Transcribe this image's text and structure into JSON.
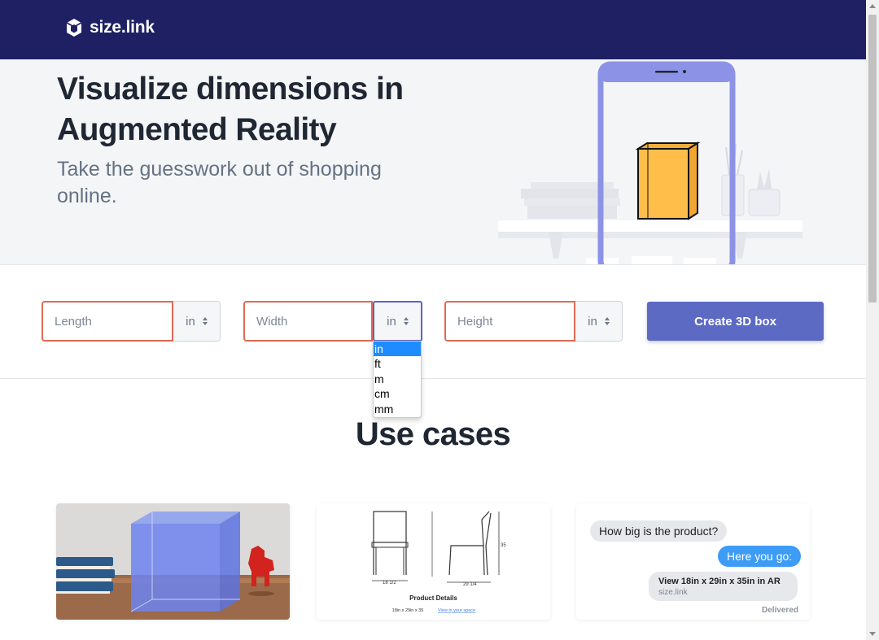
{
  "header": {
    "logo_text": "size.link",
    "logo_icon": "cube-icon"
  },
  "hero": {
    "title": "Visualize dimensions in Augmented Reality",
    "subtitle": "Take the guesswork out of shopping online."
  },
  "form": {
    "length": {
      "placeholder": "Length",
      "unit": "in"
    },
    "width": {
      "placeholder": "Width",
      "unit": "in"
    },
    "height": {
      "placeholder": "Height",
      "unit": "in"
    },
    "unit_options": [
      "in",
      "ft",
      "m",
      "cm",
      "mm"
    ],
    "selected_unit": "in",
    "create_button": "Create 3D box"
  },
  "use_cases": {
    "title": "Use cases",
    "product_card": {
      "caption": "Product Details",
      "dims": "18in x 29in x 35",
      "link": "View in your space",
      "label_a": "18 1/2",
      "label_b": "29 1/4",
      "label_c": "35"
    },
    "chat_card": {
      "question": "How big is the product?",
      "answer": "Here you go:",
      "link_title": "View 18in x 29in x 35in in AR",
      "link_domain": "size.link",
      "status": "Delivered"
    }
  },
  "colors": {
    "header_bg": "#1e2063",
    "accent": "#5c6ac4",
    "error_border": "#de6a55",
    "hero_bg": "#f4f5f7"
  }
}
